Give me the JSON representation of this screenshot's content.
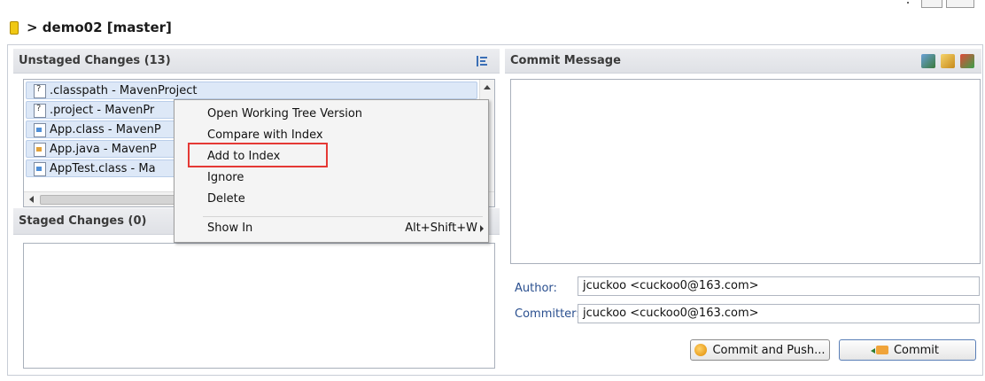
{
  "repo": {
    "title": "> demo02 [master]"
  },
  "unstaged": {
    "header": "Unstaged Changes (13)",
    "files": [
      {
        "label": ".classpath - MavenProject",
        "icon": "question-file-icon"
      },
      {
        "label": ".project - MavenPr",
        "icon": "question-file-icon"
      },
      {
        "label": "App.class - MavenP",
        "icon": "class-file-icon"
      },
      {
        "label": "App.java - MavenP",
        "icon": "java-file-icon"
      },
      {
        "label": "AppTest.class - Ma",
        "icon": "class-file-icon"
      }
    ]
  },
  "staged": {
    "header": "Staged Changes (0)"
  },
  "commit": {
    "header": "Commit Message",
    "author_label": "Author:",
    "author_value": "jcuckoo <cuckoo0@163.com>",
    "committer_label": "Committer:",
    "committer_value": "jcuckoo <cuckoo0@163.com>",
    "commit_and_push": "Commit and Push...",
    "commit": "Commit"
  },
  "context_menu": {
    "items": [
      "Open Working Tree Version",
      "Compare with Index",
      "Add to Index",
      "Ignore",
      "Delete",
      "Show In"
    ],
    "show_in_shortcut": "Alt+Shift+W"
  },
  "colors": {
    "highlight": "#e53935",
    "selection": "#dde8f7",
    "label_blue": "#2a4f8f"
  }
}
